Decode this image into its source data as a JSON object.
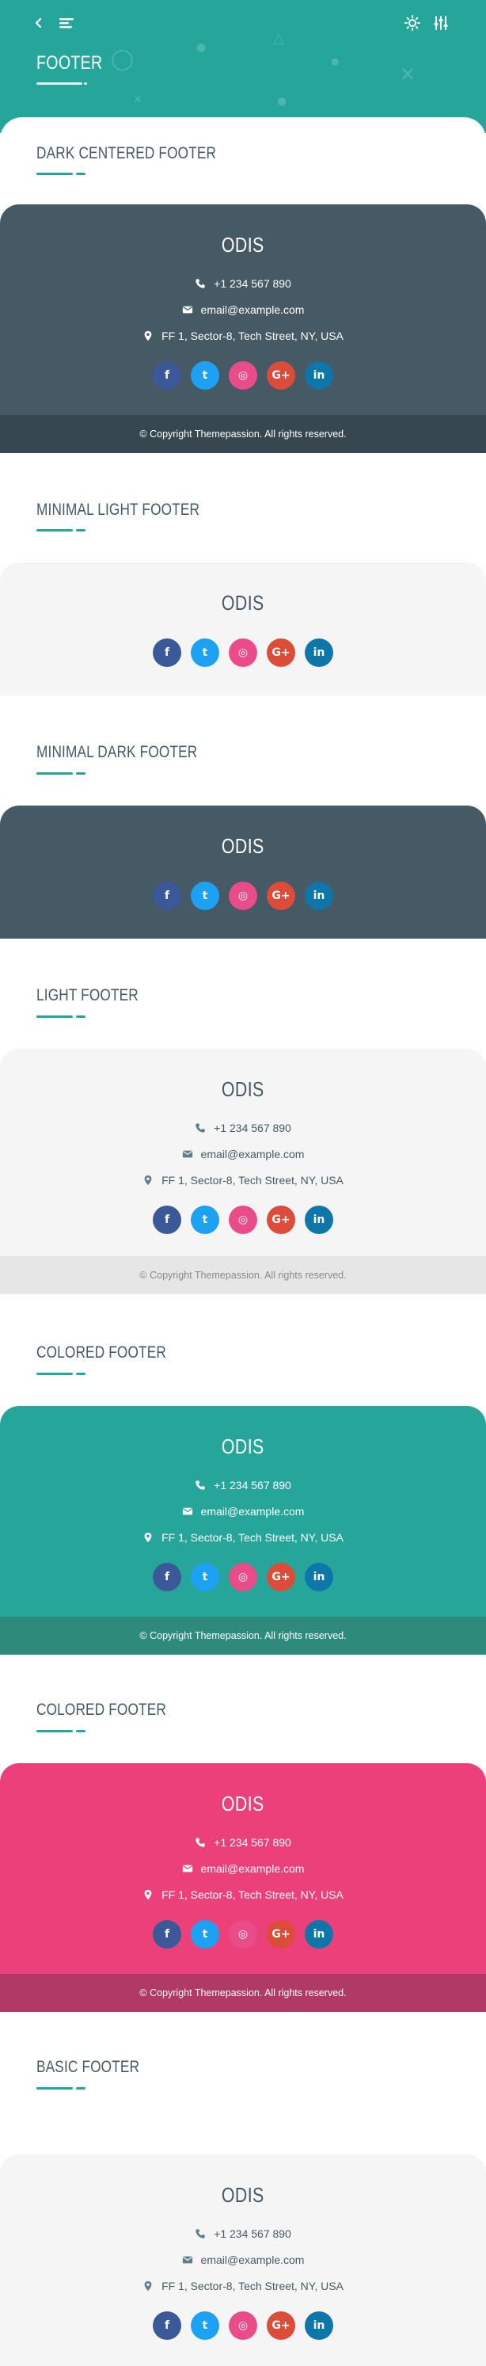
{
  "header": {
    "title": "FOOTER",
    "back_icon": "chevron-left-icon",
    "menu_icon": "menu-icon",
    "theme_icon": "sun-icon",
    "settings_icon": "sliders-icon",
    "accent_color": "#26a69a"
  },
  "brand": "ODIS",
  "contact": {
    "phone": "+1 234 567 890",
    "email": "email@example.com",
    "address": "FF 1, Sector-8, Tech Street, NY, USA"
  },
  "social_icons": [
    "facebook-icon",
    "twitter-icon",
    "dribbble-icon",
    "google-plus-icon",
    "linkedin-icon"
  ],
  "social_labels": {
    "facebook": "f",
    "twitter": "t",
    "dribbble": "◎",
    "google_plus": "G+",
    "linkedin": "in"
  },
  "copyright": "© Copyright Themepassion. All rights reserved.",
  "sections": [
    {
      "title": "DARK CENTERED FOOTER",
      "style": "dark",
      "color": "#455a64"
    },
    {
      "title": "MINIMAL LIGHT FOOTER",
      "style": "light",
      "color": "#f5f5f5"
    },
    {
      "title": "MINIMAL DARK FOOTER",
      "style": "dark",
      "color": "#455a64"
    },
    {
      "title": "LIGHT FOOTER",
      "style": "light",
      "color": "#f5f5f5"
    },
    {
      "title": "COLORED FOOTER",
      "style": "teal",
      "color": "#26a69a"
    },
    {
      "title": "COLORED FOOTER",
      "style": "pink",
      "color": "#ec407a"
    },
    {
      "title": "BASIC FOOTER",
      "style": "light",
      "color": "#f5f5f5"
    }
  ]
}
